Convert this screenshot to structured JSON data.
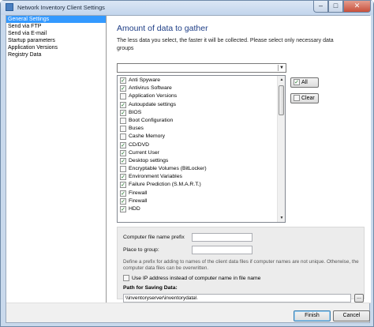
{
  "window": {
    "title": "Network Inventory Client Settings",
    "icon": "app-icon",
    "controls": {
      "minimize": "–",
      "maximize": "□",
      "close": "✕"
    }
  },
  "nav": {
    "items": [
      {
        "label": "General Settings",
        "selected": true
      },
      {
        "label": "Send via FTP",
        "selected": false
      },
      {
        "label": "Send via E-mail",
        "selected": false
      },
      {
        "label": "Startup parameters",
        "selected": false
      },
      {
        "label": "Application Versions",
        "selected": false
      },
      {
        "label": "Registry Data",
        "selected": false
      }
    ]
  },
  "main": {
    "heading": "Amount of data to gather",
    "description": "The less data you select, the faster it will be collected. Please select only necessary data groups",
    "preset_value": "",
    "data_groups": [
      {
        "label": "Anti Spyware",
        "checked": true
      },
      {
        "label": "Antivirus Software",
        "checked": true
      },
      {
        "label": "Application Versions",
        "checked": false
      },
      {
        "label": "Autoupdate settings",
        "checked": true
      },
      {
        "label": "BIOS",
        "checked": true
      },
      {
        "label": "Boot Configuration",
        "checked": false
      },
      {
        "label": "Buses",
        "checked": false
      },
      {
        "label": "Cashe Memory",
        "checked": false
      },
      {
        "label": "CD/DVD",
        "checked": true
      },
      {
        "label": "Current User",
        "checked": true
      },
      {
        "label": "Desktop settings",
        "checked": true
      },
      {
        "label": "Encryptable Volumes (BitLocker)",
        "checked": false
      },
      {
        "label": "Environment Variables",
        "checked": true
      },
      {
        "label": "Failure Prediction (S.M.A.R.T.)",
        "checked": true
      },
      {
        "label": "Firewall",
        "checked": true
      },
      {
        "label": "Firewall",
        "checked": true
      },
      {
        "label": "HDD",
        "checked": true
      }
    ],
    "all_button": "All",
    "clear_button": "Clear"
  },
  "options": {
    "prefix_label": "Computer file name prefix",
    "prefix_value": "",
    "group_label": "Place to group:",
    "group_value": "",
    "hint": "Define a prefix for adding to names of the client data files if computer names are not unique. Otherwise, the computer data files can be overwritten.",
    "use_ip_label": "Use IP address instead of computer name in file name",
    "use_ip_checked": false,
    "path_label": "Path for Saving Data:",
    "path_value": "\\\\inventoryserver\\inventorydata\\",
    "browse_label": "..."
  },
  "footer": {
    "finish": "Finish",
    "cancel": "Cancel"
  },
  "colors": {
    "selection": "#3399ff",
    "heading": "#1e3e86",
    "check": "#1f7a2a"
  }
}
